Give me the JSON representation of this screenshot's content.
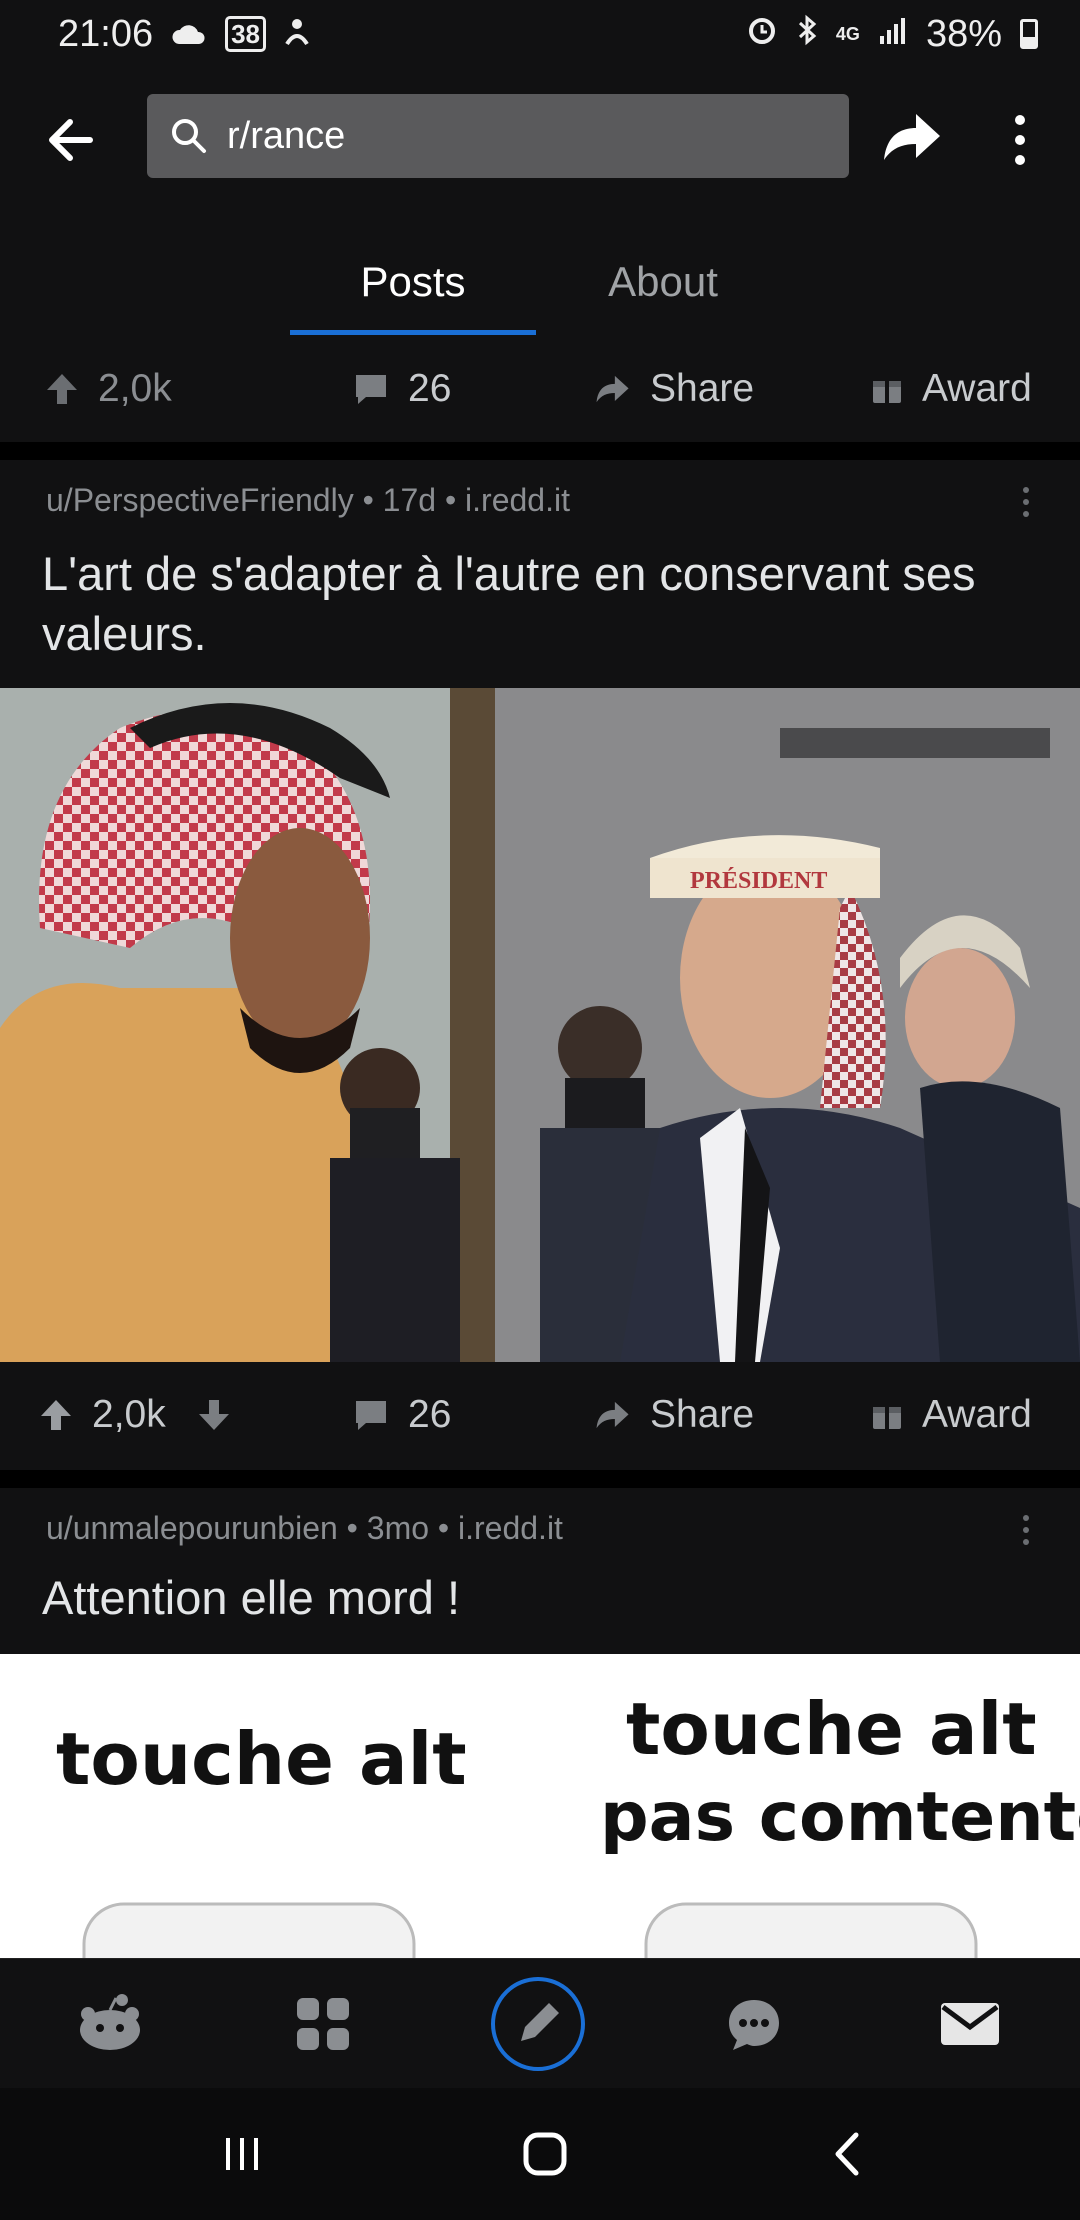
{
  "status": {
    "time": "21:06",
    "badge": "38",
    "network": "4G",
    "battery": "38%"
  },
  "toolbar": {
    "search_value": "r/rance"
  },
  "tabs": [
    {
      "label": "Posts",
      "active": true
    },
    {
      "label": "About",
      "active": false
    }
  ],
  "top_actions": {
    "votes": "2,0k",
    "comments": "26",
    "share": "Share",
    "award": "Award"
  },
  "posts": [
    {
      "author": "u/PerspectiveFriendly",
      "age": "17d",
      "domain": "i.redd.it",
      "title": "L'art de s'adapter à l'autre en conservant ses valeurs.",
      "image_text": "PRÉSIDENT",
      "votes": "2,0k",
      "comments": "26",
      "share": "Share",
      "award": "Award"
    },
    {
      "author": "u/unmalepourunbien",
      "age": "3mo",
      "domain": "i.redd.it",
      "title": "Attention elle mord !",
      "image_text_left": "touche alt",
      "image_text_right_1": "touche alt",
      "image_text_right_2": "pas comtente"
    }
  ],
  "colors": {
    "accent": "#1a6fd6",
    "background": "#111112",
    "muted": "#8b8e92"
  },
  "icons": [
    "back-arrow-icon",
    "search-icon",
    "share-icon",
    "more-vertical-icon",
    "upvote-icon",
    "downvote-icon",
    "comment-icon",
    "award-icon",
    "home-icon",
    "communities-icon",
    "create-post-icon",
    "chat-icon",
    "inbox-icon"
  ]
}
